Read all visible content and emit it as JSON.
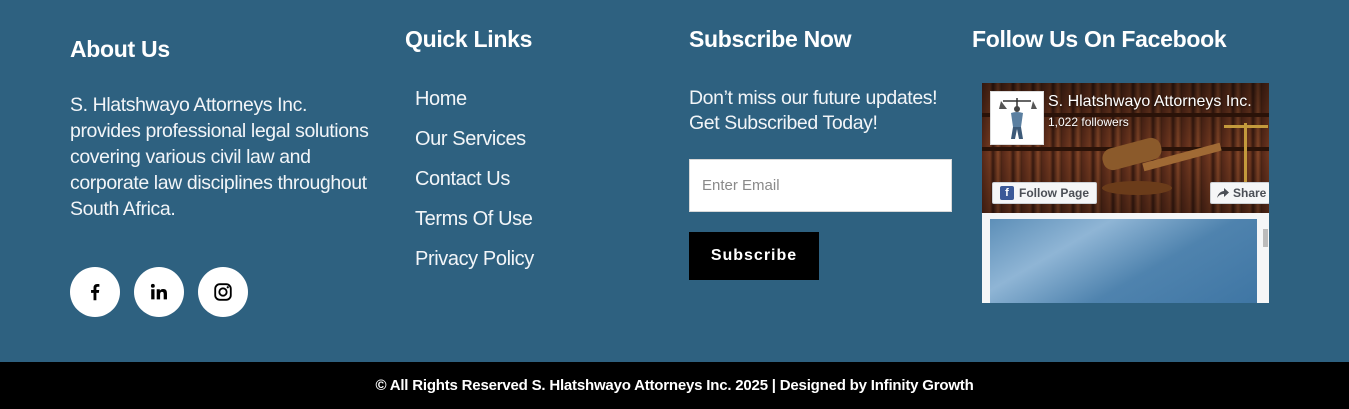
{
  "about": {
    "heading": "About Us",
    "text": "S. Hlatshwayo Attorneys Inc. provides professional legal solutions covering various civil law and corporate law disciplines throughout South Africa.",
    "socials": [
      {
        "icon": "facebook-icon"
      },
      {
        "icon": "linkedin-icon"
      },
      {
        "icon": "instagram-icon"
      }
    ]
  },
  "quick_links": {
    "heading": "Quick Links",
    "items": [
      "Home",
      "Our Services",
      "Contact Us",
      "Terms Of Use",
      "Privacy Policy"
    ]
  },
  "subscribe": {
    "heading": "Subscribe Now",
    "text": "Don’t miss our future updates! Get Subscribed Today!",
    "email_placeholder": "Enter Email",
    "button_label": "Subscribe"
  },
  "facebook": {
    "heading": "Follow Us On Facebook",
    "page_name": "S. Hlatshwayo Attorneys Inc.",
    "followers": "1,022 followers",
    "follow_label": "Follow Page",
    "share_label": "Share"
  },
  "footer": {
    "copyright": "© All Rights Reserved S. Hlatshwayo Attorneys Inc. 2025 | Designed by Infinity Growth"
  },
  "colors": {
    "background": "#2e6180",
    "bottom_bar": "#000000",
    "facebook_blue": "#3b5998"
  }
}
